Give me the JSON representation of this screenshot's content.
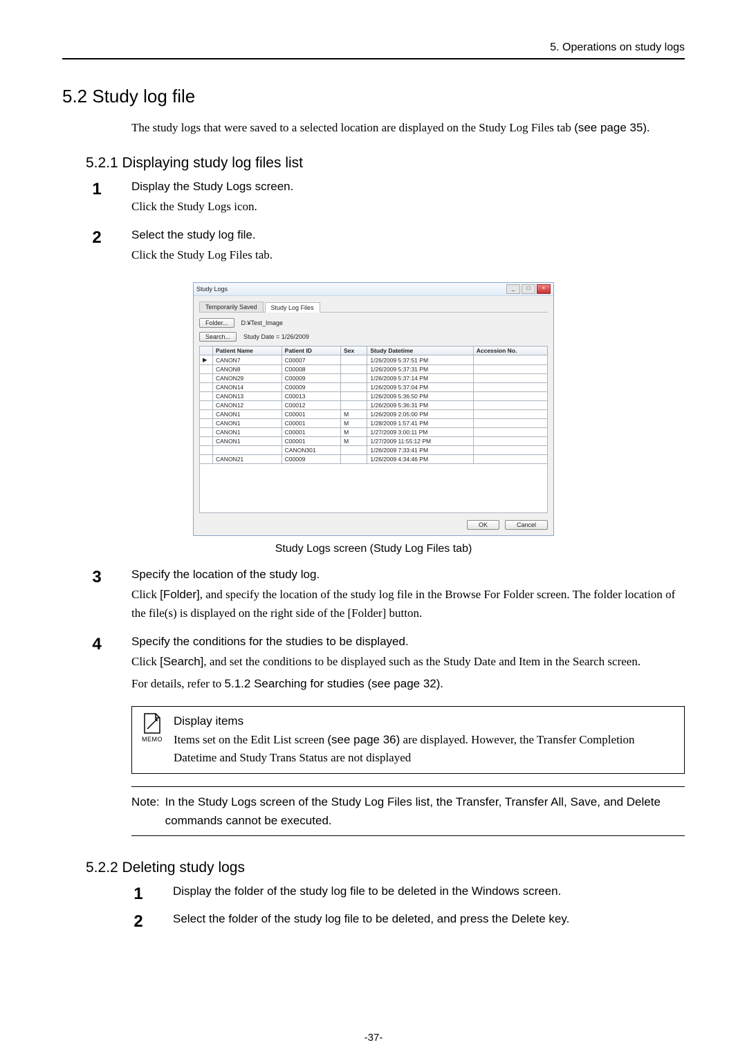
{
  "header": {
    "chapter": "5. Operations on study logs"
  },
  "section52": {
    "heading": "5.2 Study log file",
    "intro_1": "The study logs that were saved to a selected location are displayed on the Study Log Files tab",
    "intro_2": "(see page 35)",
    "intro_3": "."
  },
  "section521": {
    "heading": "5.2.1 Displaying study log files list",
    "steps": [
      {
        "num": "1",
        "title": "Display the Study Logs screen.",
        "desc": "Click the Study Logs icon."
      },
      {
        "num": "2",
        "title": "Select the study log file.",
        "desc": "Click the Study Log Files tab."
      },
      {
        "num": "3",
        "title": "Specify the location of the study log.",
        "desc_parts": [
          "Click ",
          "[Folder]",
          ", and specify the location of the study log file in the Browse For Folder screen. The folder location of the file(s) is displayed on the right side of the [Folder] button."
        ]
      },
      {
        "num": "4",
        "title": "Specify the conditions for the studies to be displayed.",
        "desc1_parts": [
          "Click ",
          "[Search]",
          ", and set the conditions to be displayed such as the Study Date and Item in the Search screen."
        ],
        "desc2_parts": [
          "For details, refer to ",
          "5.1.2 Searching for studies (see page 32)",
          "."
        ]
      }
    ],
    "caption": "Study Logs screen (Study Log Files tab)"
  },
  "screenshot": {
    "title": "Study Logs",
    "tabs": {
      "temp": "Temporarily Saved",
      "files": "Study Log Files"
    },
    "folder_btn": "Folder...",
    "folder_path": "D:¥Test_Image",
    "search_btn": "Search...",
    "search_text": "Study Date  =  1/26/2009",
    "columns": [
      "Patient Name",
      "Patient ID",
      "Sex",
      "Study Datetime",
      "Accession No."
    ],
    "rows": [
      {
        "name": "CANON7",
        "id": "C00007",
        "sex": "",
        "dt": "1/26/2009 5:37:51 PM",
        "acc": ""
      },
      {
        "name": "CANON8",
        "id": "C00008",
        "sex": "",
        "dt": "1/26/2009 5:37:31 PM",
        "acc": ""
      },
      {
        "name": "CANON29",
        "id": "C00009",
        "sex": "",
        "dt": "1/26/2009 5:37:14 PM",
        "acc": ""
      },
      {
        "name": "CANON14",
        "id": "C00009",
        "sex": "",
        "dt": "1/26/2009 5:37:04 PM",
        "acc": ""
      },
      {
        "name": "CANON13",
        "id": "C00013",
        "sex": "",
        "dt": "1/26/2009 5:36:50 PM",
        "acc": ""
      },
      {
        "name": "CANON12",
        "id": "C00012",
        "sex": "",
        "dt": "1/26/2009 5:36:31 PM",
        "acc": ""
      },
      {
        "name": "CANON1",
        "id": "C00001",
        "sex": "M",
        "dt": "1/26/2009 2:05:00 PM",
        "acc": ""
      },
      {
        "name": "CANON1",
        "id": "C00001",
        "sex": "M",
        "dt": "1/28/2009 1:57:41 PM",
        "acc": ""
      },
      {
        "name": "CANON1",
        "id": "C00001",
        "sex": "M",
        "dt": "1/27/2009 3:00:11 PM",
        "acc": ""
      },
      {
        "name": "CANON1",
        "id": "C00001",
        "sex": "M",
        "dt": "1/27/2009 11:55:12 PM",
        "acc": ""
      },
      {
        "name": "",
        "id": "CANON301",
        "sex": "",
        "dt": "1/26/2009 7:33:41 PM",
        "acc": ""
      },
      {
        "name": "CANON21",
        "id": "C00009",
        "sex": "",
        "dt": "1/26/2009 4:34:46 PM",
        "acc": ""
      }
    ],
    "ok": "OK",
    "cancel": "Cancel"
  },
  "memo": {
    "icon_label": "MEMO",
    "title": "Display items",
    "body_parts": [
      "Items set on the Edit List screen ",
      "(see page 36)",
      " are displayed. However, the Transfer Completion Datetime and Study Trans Status are not displayed"
    ]
  },
  "note": {
    "label": "Note:",
    "text": "In the Study Logs screen of the Study Log Files list, the Transfer, Transfer All, Save, and Delete commands cannot be executed."
  },
  "section522": {
    "heading": "5.2.2 Deleting study logs",
    "steps": [
      {
        "num": "1",
        "title": "Display the folder of the study log file to be deleted in the Windows screen."
      },
      {
        "num": "2",
        "title": "Select the folder of the study log file to be deleted, and press the Delete key."
      }
    ]
  },
  "page_number": "-37-"
}
